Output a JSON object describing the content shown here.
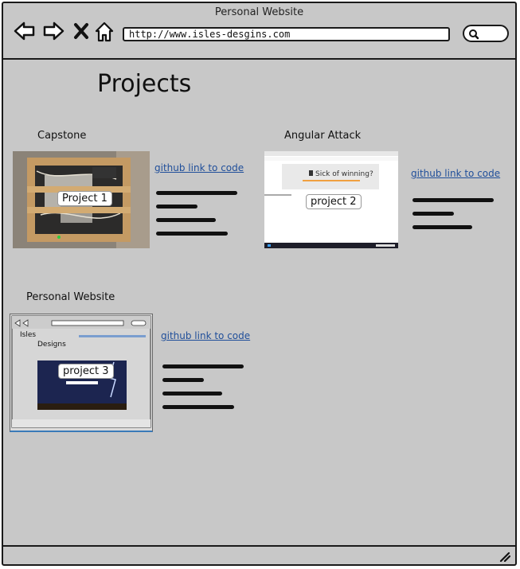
{
  "window": {
    "title": "Personal Website",
    "url": "http://www.isles-desgins.com"
  },
  "page": {
    "title": "Projects"
  },
  "projects": [
    {
      "name": "Capstone",
      "thumb_label": "Project 1",
      "link": "github link to code"
    },
    {
      "name": "Angular Attack",
      "thumb_label": "project 2",
      "link": "github link to code",
      "thumb_text": "Sick of winning?"
    },
    {
      "name": "Personal Website",
      "thumb_label": "project 3",
      "link": "github link to code",
      "thumb_brand1": "Isles",
      "thumb_brand2": "Designs"
    }
  ],
  "icons": [
    "back-arrow-icon",
    "forward-arrow-icon",
    "close-icon",
    "home-icon",
    "search-icon",
    "resize-grip-icon"
  ],
  "colors": {
    "chrome": "#c8c8c8",
    "link": "#1f4e9a",
    "outline": "#1a1a1a"
  }
}
